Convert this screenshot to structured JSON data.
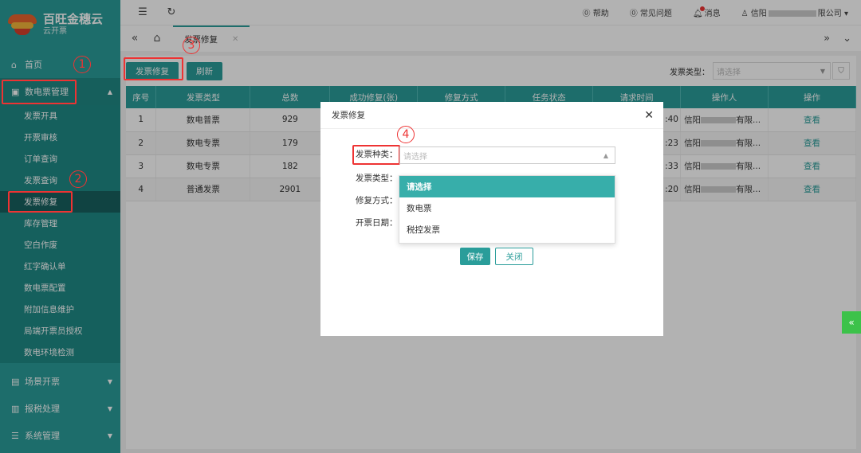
{
  "brand": {
    "name": "百旺金穗云",
    "subtitle": "云开票"
  },
  "sidebar": {
    "home": "首页",
    "groups": [
      {
        "label": "数电票管理",
        "open": true
      },
      {
        "label": "场景开票"
      },
      {
        "label": "报税处理"
      },
      {
        "label": "系统管理"
      }
    ],
    "sub_items": [
      "发票开具",
      "开票审核",
      "订单查询",
      "发票查询",
      "发票修复",
      "库存管理",
      "空白作废",
      "红字确认单",
      "数电票配置",
      "附加信息维护",
      "局端开票员授权",
      "数电环境检测"
    ],
    "active_sub": "发票修复"
  },
  "header": {
    "help": "帮助",
    "faq": "常见问题",
    "messages": "消息",
    "user_prefix": "信阳",
    "user_suffix": "限公司"
  },
  "tabs": [
    {
      "label": "发票修复"
    }
  ],
  "toolbar": {
    "repair_btn": "发票修复",
    "refresh_btn": "刷新"
  },
  "filter": {
    "label": "发票类型：",
    "placeholder": "请选择"
  },
  "table": {
    "headers": [
      "序号",
      "发票类型",
      "总数",
      "成功修复(张)",
      "修复方式",
      "任务状态",
      "请求时间",
      "操作人",
      "操作"
    ],
    "rows": [
      {
        "no": "1",
        "type": "数电普票",
        "total": "929",
        "time": ":40",
        "op_prefix": "信阳",
        "op_suffix": "有限...",
        "action": "查看"
      },
      {
        "no": "2",
        "type": "数电专票",
        "total": "179",
        "time": ":23",
        "op_prefix": "信阳",
        "op_suffix": "有限...",
        "action": "查看"
      },
      {
        "no": "3",
        "type": "数电专票",
        "total": "182",
        "time": ":33",
        "op_prefix": "信阳",
        "op_suffix": "有限...",
        "action": "查看"
      },
      {
        "no": "4",
        "type": "普通发票",
        "total": "2901",
        "time": ":20",
        "op_prefix": "信阳",
        "op_suffix": "有限...",
        "action": "查看"
      }
    ]
  },
  "modal": {
    "title": "发票修复",
    "fields": {
      "category": "发票种类：",
      "type": "发票类型：",
      "method": "修复方式：",
      "date": "开票日期："
    },
    "category_placeholder": "请选择",
    "options": [
      "请选择",
      "数电票",
      "税控发票"
    ],
    "save": "保存",
    "close": "关闭"
  },
  "annotations": [
    "1",
    "2",
    "3",
    "4"
  ],
  "colors": {
    "primary": "#2a9d9a",
    "highlight": "#e33333"
  }
}
